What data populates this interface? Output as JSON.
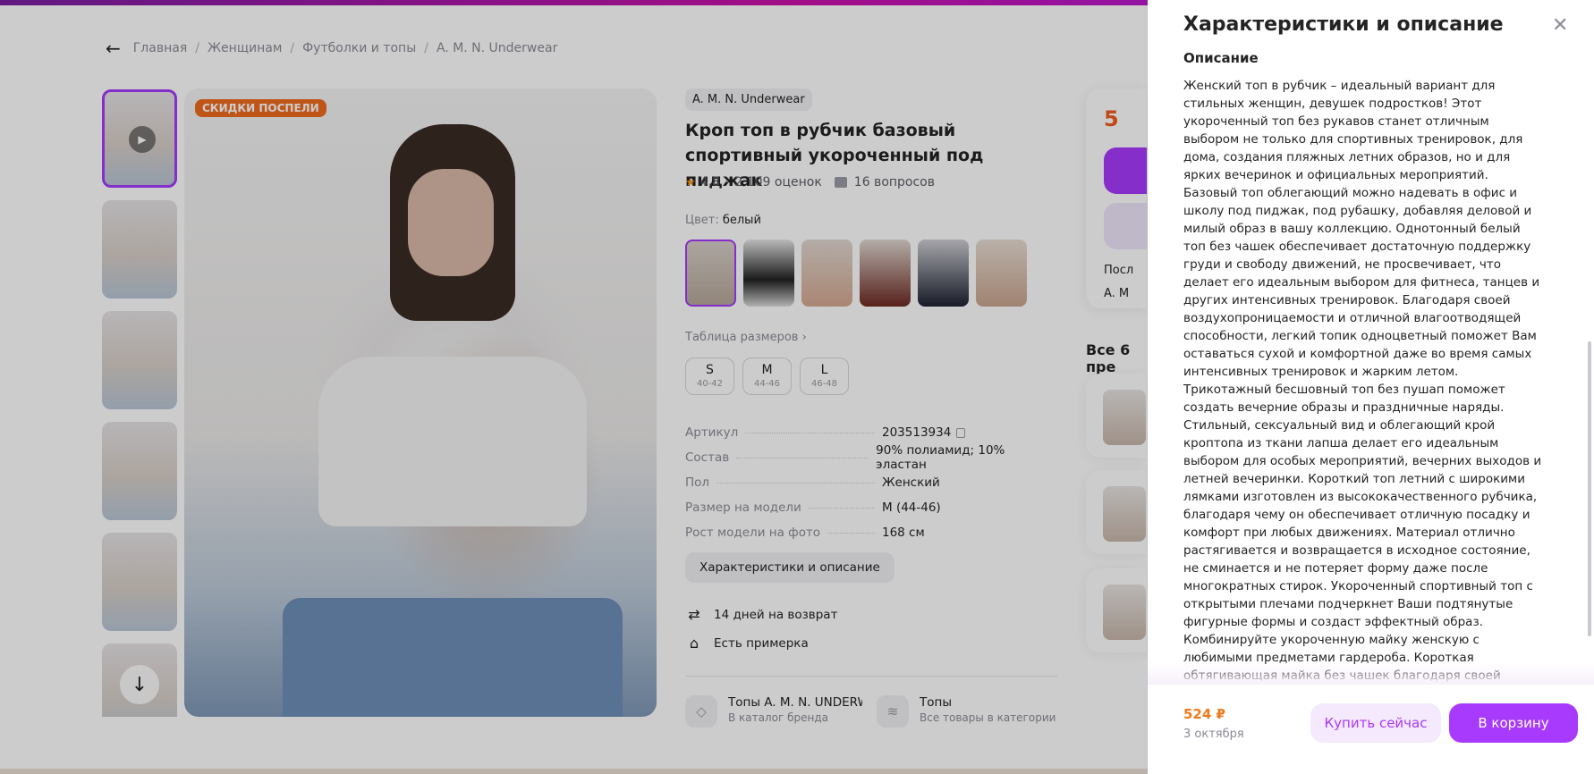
{
  "breadcrumb": {
    "items": [
      "Главная",
      "Женщинам",
      "Футболки и топы",
      "A. M. N. Underwear"
    ]
  },
  "product": {
    "sale_badge": "СКИДКИ ПОСПЕЛИ",
    "brand": "A. M. N. Underwear",
    "title": "Кроп топ в рубчик базовый спортивный укороченный под пиджак",
    "rating": "4,8",
    "reviews": "2 109 оценок",
    "questions": "16 вопросов",
    "color_label": "Цвет:",
    "color_value": "белый",
    "size_table_link": "Таблица размеров ›",
    "sizes": [
      {
        "label": "S",
        "range": "40-42"
      },
      {
        "label": "M",
        "range": "44-46"
      },
      {
        "label": "L",
        "range": "46-48"
      }
    ],
    "specs": [
      {
        "key": "Артикул",
        "value": "203513934"
      },
      {
        "key": "Состав",
        "value": "90% полиамид; 10% эластан"
      },
      {
        "key": "Пол",
        "value": "Женский"
      },
      {
        "key": "Размер на модели",
        "value": "M (44-46)"
      },
      {
        "key": "Рост модели на фото",
        "value": "168 см"
      }
    ],
    "characteristics_button": "Характеристики и описание",
    "return_text": "14 дней на возврат",
    "fitting_text": "Есть примерка",
    "brand_link": {
      "title": "Топы A. M. N. UNDERWEAR",
      "sub": "В каталог бренда"
    },
    "category_link": {
      "title": "Топы",
      "sub": "Все товары в категории"
    }
  },
  "right_column": {
    "price_partial": "5",
    "row1_partial": "Посл",
    "row2_partial": "A. M",
    "all_sellers_partial": "Все 6 пре"
  },
  "drawer": {
    "title": "Характеристики и описание",
    "subheading": "Описание",
    "description": "Женский топ в рубчик – идеальный вариант для стильных женщин, девушек подростков! Этот укороченный топ без рукавов станет отличным выбором не только для спортивных тренировок, для дома, создания пляжных летних образов, но и для ярких вечеринок и официальных мероприятий. Базовый топ облегающий можно надевать в офис и школу под пиджак, под рубашку, добавляя деловой и милый образ в вашу коллекцию. Однотонный белый топ без чашек обеспечивает достаточную поддержку груди и свободу движений, не просвечивает, что делает его идеальным выбором для фитнеса, танцев и других интенсивных тренировок. Благодаря своей воздухопроницаемости и отличной влагоотводящей способности, легкий топик одноцветный поможет Вам оставаться сухой и комфортной даже во время самых интенсивных тренировок и жарким летом. Трикотажный бесшовный топ без пушап поможет создать вечерние образы и праздничные наряды. Стильный, сексуальный вид и облегающий крой кроптопа из ткани лапша делает его идеальным выбором для особых мероприятий, вечерних выходов и летней вечеринки. Короткий топ летний с широкими лямками изготовлен из высококачественного рубчика, благодаря чему он обеспечивает отличную посадку и комфорт при любых движениях. Материал отлично растягивается и возвращается в исходное состояние, не сминается и не потеряет форму даже после многократных стирок. Укороченный спортивный топ с открытыми плечами подчеркнет Ваши подтянутые фигурные формы и создаст эффектный образ. Комбинируйте укороченную майку женскую с любимыми предметами гардероба. Короткая обтягивающая майка без чашек благодаря своей универсальности подходит для любого сезона и множества повседневных или праздничных событий, а также как домашний вариант. Укороченная футболка создана для всех, кто ценит стильную, модную и качественную женскую одежду. Добавляй подростковый топ без бретелей в свой гардероб! Кроп топ станет незаменимым предметом",
    "footer_price": "524 ₽",
    "footer_date": "3 октября",
    "buy_now": "Купить сейчас",
    "add_to_cart": "В корзину"
  },
  "colors": {
    "accent": "#a73afd",
    "price": "#f07a1c",
    "sale_badge": "#f06b1e"
  }
}
